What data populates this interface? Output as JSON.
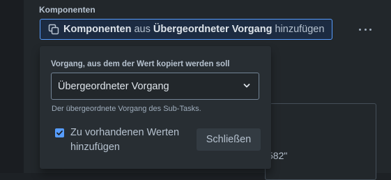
{
  "section": {
    "label": "Komponenten"
  },
  "action": {
    "icon": "copy-icon",
    "part1": "Komponenten",
    "part2": " aus ",
    "part3": "Übergeordneter Vorgang",
    "part4": " hinzufügen"
  },
  "more": {
    "icon": "more-horizontal-icon"
  },
  "background": {
    "fragment": "582\""
  },
  "popup": {
    "field_label": "Vorgang, aus dem der Wert kopiert werden soll",
    "select_value": "Übergeordneter Vorgang",
    "helper_text": "Der übergeordnete Vorgang des Sub-Tasks.",
    "checkbox_checked": true,
    "checkbox_label": "Zu vorhandenen Werten hinzufügen",
    "close_label": "Schließen"
  },
  "colors": {
    "accent": "#579dff",
    "background": "#1d2125",
    "popup": "#282e33"
  }
}
